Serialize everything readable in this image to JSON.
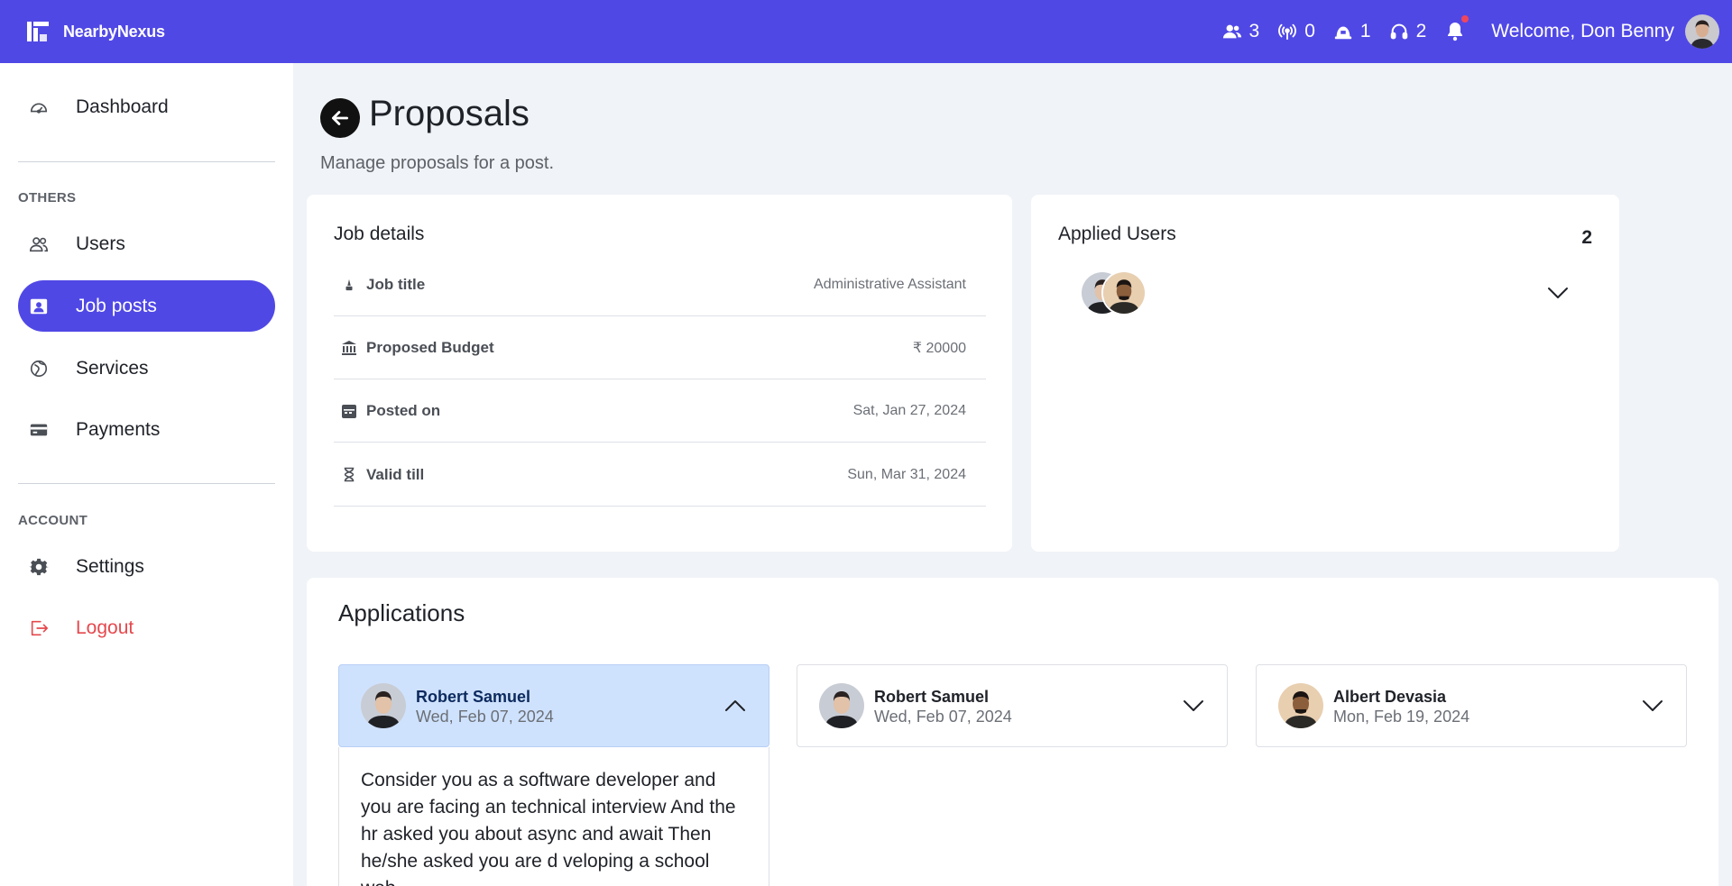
{
  "brand": {
    "name": "NearbyNexus"
  },
  "topbar": {
    "stats": [
      {
        "icon": "users-icon",
        "value": "3"
      },
      {
        "icon": "broadcast-icon",
        "value": "0"
      },
      {
        "icon": "hat-icon",
        "value": "1"
      },
      {
        "icon": "headset-icon",
        "value": "2"
      }
    ],
    "welcome": "Welcome, Don Benny"
  },
  "sidebar": {
    "dashboard": "Dashboard",
    "others_label": "OTHERS",
    "items": [
      {
        "label": "Users",
        "icon": "users-icon"
      },
      {
        "label": "Job posts",
        "icon": "badge-icon"
      },
      {
        "label": "Services",
        "icon": "services-icon"
      },
      {
        "label": "Payments",
        "icon": "card-icon"
      }
    ],
    "account_label": "ACCOUNT",
    "settings": "Settings",
    "logout": "Logout"
  },
  "header": {
    "title": "Proposals",
    "subtitle": "Manage proposals for a post."
  },
  "job_details": {
    "title": "Job details",
    "rows": [
      {
        "label": "Job title",
        "value": "Administrative Assistant"
      },
      {
        "label": "Proposed Budget",
        "value": "₹ 20000"
      },
      {
        "label": "Posted on",
        "value": "Sat, Jan 27, 2024"
      },
      {
        "label": "Valid till",
        "value": "Sun, Mar 31, 2024"
      }
    ]
  },
  "applied_users": {
    "title": "Applied Users",
    "count": "2"
  },
  "applications": {
    "title": "Applications",
    "items": [
      {
        "name": "Robert Samuel",
        "date": "Wed, Feb 07, 2024",
        "expanded": true
      },
      {
        "name": "Robert Samuel",
        "date": "Wed, Feb 07, 2024",
        "expanded": false
      },
      {
        "name": "Albert Devasia",
        "date": "Mon, Feb 19, 2024",
        "expanded": false
      }
    ],
    "expanded_text": "Consider you as a software developer and you are facing an technical interview And the hr asked you about async and await Then he/she asked you are d veloping a school web"
  },
  "colors": {
    "primary": "#5048e5",
    "logout": "#e5484d",
    "expanded_bg": "#cfe2fd",
    "background": "#f0f3f7"
  }
}
